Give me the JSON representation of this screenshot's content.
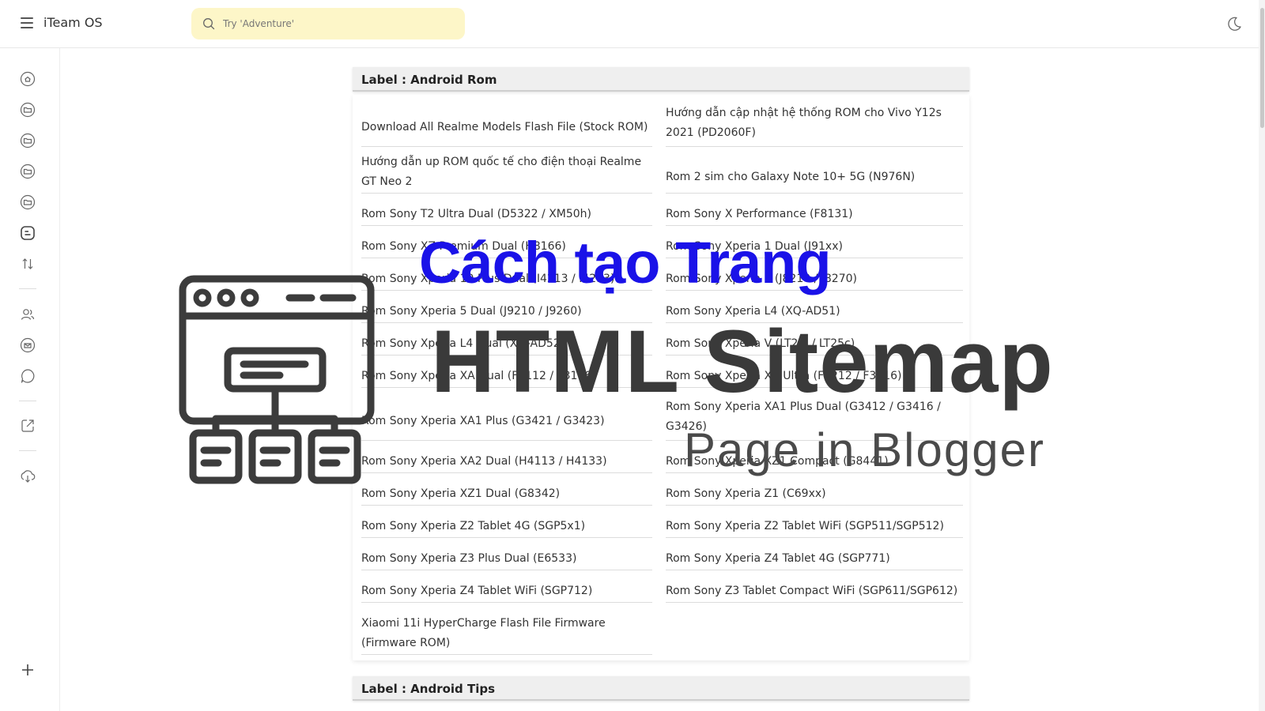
{
  "header": {
    "app_title": "iTeam OS",
    "search_placeholder": "Try 'Adventure'"
  },
  "icons": {
    "menu": "hamburger-menu-icon",
    "search": "search-icon",
    "theme": "moon-icon",
    "sidebar": [
      "home-icon",
      "folder-icon",
      "folder-icon",
      "folder-icon",
      "folder-icon",
      "blog-icon",
      "sort-icon",
      "users-icon",
      "mail-icon",
      "chat-icon",
      "external-link-icon",
      "download-icon",
      "plus-icon"
    ]
  },
  "sections": [
    {
      "label": "Label : Android Rom",
      "posts": [
        "Download All Realme Models Flash File (Stock ROM)",
        "Hướng dẫn cập nhật hệ thống ROM cho Vivo Y12s 2021 (PD2060F)",
        "Hướng dẫn up ROM quốc tế cho điện thoại Realme GT Neo 2",
        "Rom 2 sim cho Galaxy Note 10+ 5G (N976N)",
        "Rom Sony T2 Ultra Dual (D5322 / XM50h)",
        "Rom Sony X Performance (F8131)",
        "Rom Sony XZ Premium Dual (H8166)",
        "Rom Sony Xperia 1 Dual (J91xx)",
        "Rom Sony Xperia 10 Plus Dual (I4213 / I4293)",
        "Rom Sony Xperia 5 (J8210 / J8270)",
        "Rom Sony Xperia 5 Dual (J9210 / J9260)",
        "Rom Sony Xperia L4 (XQ-AD51)",
        "Rom Sony Xperia L4 Dual (XQ-AD52)",
        "Rom Sony Xperia V (LT25i / LT25c)",
        "Rom Sony Xperia XA Dual (F3112 / F3116)",
        "Rom Sony Xperia XA Ultra (F3212 / F3216)",
        "Rom Sony Xperia XA1 Plus (G3421 / G3423)",
        "Rom Sony Xperia XA1 Plus Dual (G3412 / G3416 / G3426)",
        "Rom Sony Xperia XA2 Dual (H4113 / H4133)",
        "Rom Sony Xperia XZ1 Compact (G8441)",
        "Rom Sony Xperia XZ1 Dual (G8342)",
        "Rom Sony Xperia Z1 (C69xx)",
        "Rom Sony Xperia Z2 Tablet 4G (SGP5x1)",
        "Rom Sony Xperia Z2 Tablet WiFi (SGP511/SGP512)",
        "Rom Sony Xperia Z3 Plus Dual (E6533)",
        "Rom Sony Xperia Z4 Tablet 4G (SGP771)",
        "Rom Sony Xperia Z4 Tablet WiFi (SGP712)",
        "Rom Sony Z3 Tablet Compact WiFi (SGP611/SGP612)",
        "Xiaomi 11i HyperCharge Flash File Firmware (Firmware ROM)"
      ]
    },
    {
      "label": "Label : Android Tips",
      "posts": []
    }
  ],
  "overlay": {
    "line1": "Cách tạo Trang",
    "line2": "HTML Sitemap",
    "line3": "Page in Blogger"
  },
  "colors": {
    "search_bg": "#fdf6c8",
    "overlay_blue": "#1a12e8",
    "overlay_dark": "#3a3a3a"
  }
}
